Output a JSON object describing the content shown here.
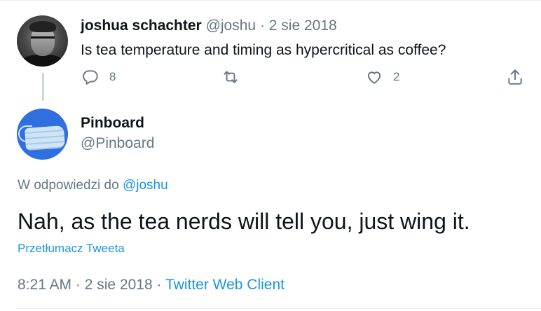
{
  "parent_tweet": {
    "display_name": "joshua schachter",
    "handle": "@joshu",
    "separator": "·",
    "date": "2 sie 2018",
    "text": "Is tea temperature and timing as hypercritical as coffee?",
    "reply_count": "8",
    "like_count": "2",
    "icons": [
      "reply-icon",
      "retweet-icon",
      "like-icon",
      "share-icon"
    ]
  },
  "main_tweet": {
    "display_name": "Pinboard",
    "handle": "@Pinboard",
    "reply_to_prefix": "W odpowiedzi do",
    "reply_to_handle": "@joshu",
    "text": "Nah, as the tea nerds will tell you, just wing it.",
    "translate_label": "Przetłumacz Tweeta",
    "time": "8:21 AM",
    "separator": "·",
    "date": "2 sie 2018",
    "separator2": "·",
    "client": "Twitter Web Client"
  },
  "colors": {
    "link": "#1b95e0",
    "muted": "#657786",
    "text": "#0f1419",
    "divider": "#e6ecf0"
  }
}
